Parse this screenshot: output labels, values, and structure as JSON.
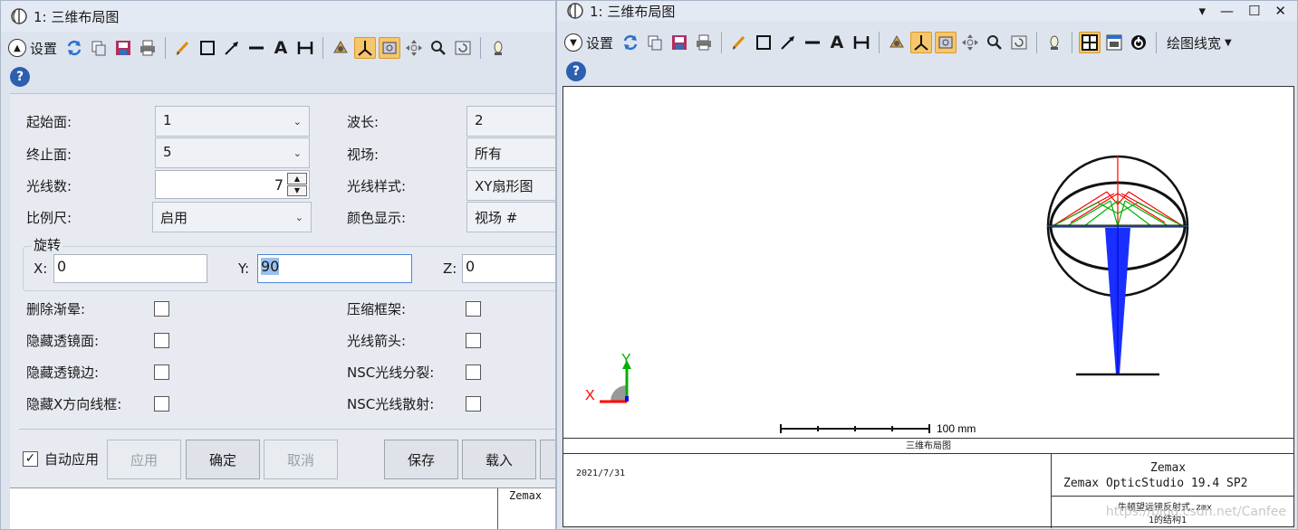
{
  "left": {
    "title": "1: 三维布局图",
    "toolbar": {
      "settings_label": "设置"
    },
    "form": {
      "start_surface": {
        "label": "起始面:",
        "value": "1"
      },
      "end_surface": {
        "label": "终止面:",
        "value": "5"
      },
      "num_rays": {
        "label": "光线数:",
        "value": "7"
      },
      "scale": {
        "label": "比例尺:",
        "value": "启用"
      },
      "wavelength": {
        "label": "波长:",
        "value": "2"
      },
      "field": {
        "label": "视场:",
        "value": "所有"
      },
      "ray_pattern": {
        "label": "光线样式:",
        "value": "XY扇形图"
      },
      "color_by": {
        "label": "颜色显示:",
        "value": "视场 #"
      },
      "rotation": {
        "title": "旋转",
        "x_label": "X:",
        "x_value": "0",
        "y_label": "Y:",
        "y_value": "90",
        "z_label": "Z:",
        "z_value": "0"
      },
      "delete_vignetted": {
        "label": "删除渐晕:",
        "checked": false
      },
      "hide_lens_faces": {
        "label": "隐藏透镜面:",
        "checked": false
      },
      "hide_lens_edges": {
        "label": "隐藏透镜边:",
        "checked": false
      },
      "hide_x_bars": {
        "label": "隐藏X方向线框:",
        "checked": false
      },
      "suppress_frame": {
        "label": "压缩框架:",
        "checked": false
      },
      "ray_arrows": {
        "label": "光线箭头:",
        "checked": false
      },
      "nsc_split": {
        "label": "NSC光线分裂:",
        "checked": false
      },
      "nsc_scatter": {
        "label": "NSC光线散射:",
        "checked": false
      }
    },
    "buttons": {
      "auto_apply_label": "自动应用",
      "auto_apply_checked": true,
      "apply": "应用",
      "ok": "确定",
      "cancel": "取消",
      "save": "保存",
      "load": "载入"
    },
    "bottom_cell": "Zemax"
  },
  "right": {
    "title": "1: 三维布局图",
    "toolbar": {
      "settings_label": "设置",
      "line_width_label": "绘图线宽"
    },
    "plot": {
      "scale_label": "100 mm",
      "axis_x": "X",
      "axis_y": "Y",
      "footer_title": "三维布局图",
      "date": "2021/7/31",
      "company": "Zemax",
      "product": "Zemax OpticStudio 19.4 SP2",
      "file": "牛顿望远镜反射式.zmx",
      "config": "1的结构1",
      "watermark": "https://blog.csdn.net/Canfee"
    }
  },
  "colors": {
    "ray_field1": "#0000ff",
    "ray_field2": "#00c000",
    "ray_field3": "#ff0000",
    "active_tool": "#f7c66b"
  }
}
